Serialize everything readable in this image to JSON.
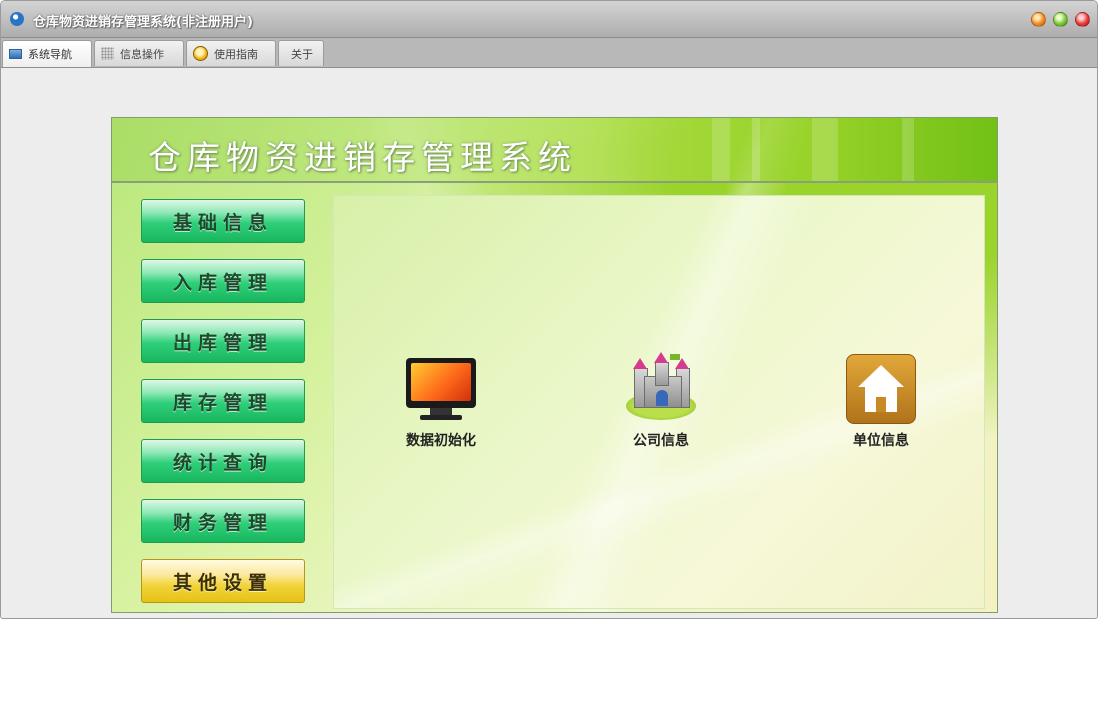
{
  "window": {
    "title": "仓库物资进销存管理系统(非注册用户)"
  },
  "tabs": [
    {
      "label": "系统导航",
      "icon": "monitor-icon",
      "active": true
    },
    {
      "label": "信息操作",
      "icon": "grid-icon",
      "active": false
    },
    {
      "label": "使用指南",
      "icon": "guide-icon",
      "active": false
    },
    {
      "label": "关于",
      "icon": "",
      "active": false
    }
  ],
  "panel": {
    "title": "仓库物资进销存管理系统"
  },
  "nav": [
    {
      "label": "基础信息",
      "active": false
    },
    {
      "label": "入库管理",
      "active": false
    },
    {
      "label": "出库管理",
      "active": false
    },
    {
      "label": "库存管理",
      "active": false
    },
    {
      "label": "统计查询",
      "active": false
    },
    {
      "label": "财务管理",
      "active": false
    },
    {
      "label": "其他设置",
      "active": true
    }
  ],
  "features": [
    {
      "label": "数据初始化",
      "icon": "monitor-icon"
    },
    {
      "label": "公司信息",
      "icon": "castle-icon"
    },
    {
      "label": "单位信息",
      "icon": "house-icon"
    }
  ],
  "colors": {
    "nav_button": "#2fcf7a",
    "nav_button_active": "#f1d43c",
    "panel_green": "#9ad32a"
  }
}
